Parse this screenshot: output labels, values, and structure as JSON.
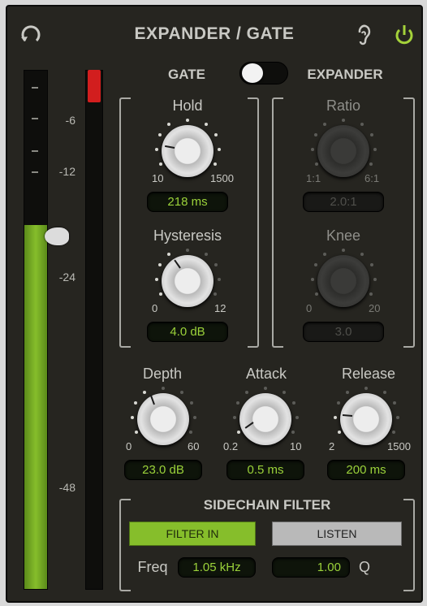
{
  "header": {
    "title": "EXPANDER / GATE",
    "reset_icon": "reset-arrow-icon",
    "listen_icon": "ear-icon",
    "power_icon": "power-icon",
    "power_color": "#a4d23a"
  },
  "meter": {
    "scale_labels": [
      "-6",
      "-12",
      "-24",
      "-48"
    ],
    "input_level_fraction": 0.7,
    "threshold_handle_level_fraction": 0.68,
    "fill_color": "#86be2b",
    "clip_color": "#d21e1e"
  },
  "mode": {
    "left_label": "GATE",
    "right_label": "EXPANDER",
    "selected": "GATE"
  },
  "gate": {
    "hold": {
      "label": "Hold",
      "min": "10",
      "max": "1500",
      "value": "218 ms"
    },
    "hysteresis": {
      "label": "Hysteresis",
      "min": "0",
      "max": "12",
      "value": "4.0 dB"
    }
  },
  "expander": {
    "ratio": {
      "label": "Ratio",
      "min": "1:1",
      "max": "6:1",
      "value": "2.0:1"
    },
    "knee": {
      "label": "Knee",
      "min": "0",
      "max": "20",
      "value": "3.0"
    }
  },
  "common": {
    "depth": {
      "label": "Depth",
      "min": "0",
      "max": "60",
      "value": "23.0 dB"
    },
    "attack": {
      "label": "Attack",
      "min": "0.2",
      "max": "10",
      "value": "0.5 ms"
    },
    "release": {
      "label": "Release",
      "min": "2",
      "max": "1500",
      "value": "200 ms"
    }
  },
  "sidechain": {
    "title": "SIDECHAIN FILTER",
    "filter_in_label": "FILTER IN",
    "listen_label": "LISTEN",
    "freq_label": "Freq",
    "freq_value": "1.05 kHz",
    "q_value": "1.00",
    "q_label": "Q"
  }
}
